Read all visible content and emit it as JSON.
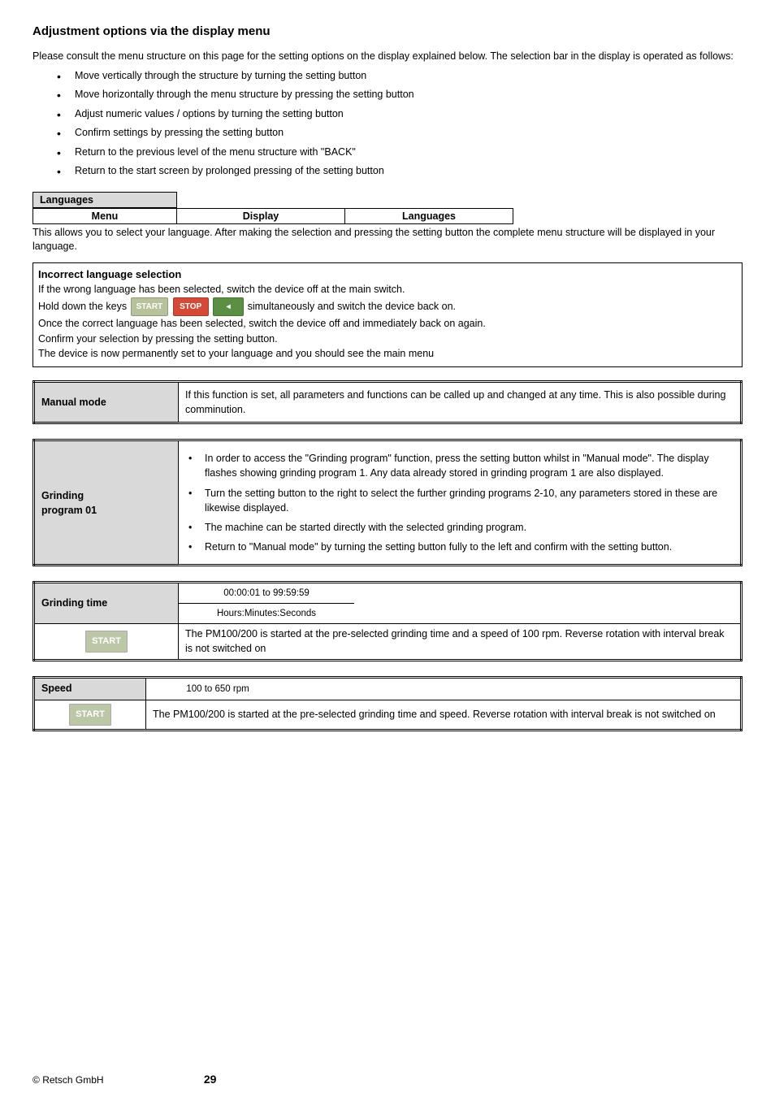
{
  "title": "Adjustment options via the display menu",
  "intro": "Please consult the menu structure on this page for the setting options on the display explained below. The selection bar in the display is operated as follows:",
  "bullets": [
    "Move vertically through the structure by turning the setting button",
    "Move horizontally through the menu structure by pressing the setting button",
    "Adjust numeric values / options by turning the setting button",
    "Confirm settings by pressing the setting button",
    "Return to the previous level of the menu structure with \"BACK\"",
    "Return to the start screen by prolonged pressing of the setting button"
  ],
  "lang": {
    "header": "Languages",
    "col1": "Menu",
    "col2": "Display",
    "col3": "Languages",
    "note": "This allows you to select your language. After making the selection and pressing the setting button the complete menu structure will be displayed in your language."
  },
  "warn": {
    "title": "Incorrect language selection",
    "l1": "If the wrong language has been selected, switch the device off at the main switch.",
    "prehold": "Hold down the keys ",
    "posthold": " simultaneously and switch the device back on.",
    "l3": "Once the correct language has been selected, switch the device off and immediately back on again.",
    "l4": "Confirm your selection by pressing the setting button.",
    "l5": "The device is now permanently set to your language and you should see the main menu"
  },
  "buttons": {
    "start": "START",
    "stop": "STOP",
    "open": "◂"
  },
  "manual": {
    "label": "Manual mode",
    "text": "If this function is set, all parameters and functions can be called up and changed at any time. This is also possible during comminution."
  },
  "grindprog": {
    "label_l1": "Grinding",
    "label_l2": "program  01",
    "items": [
      "In order to access the \"Grinding program\" function, press the setting button whilst in \"Manual mode\". The display flashes showing grinding program 1. Any data already stored in grinding program 1 are also displayed.",
      "Turn the setting button to the right to select the further grinding programs 2-10, any parameters stored in these are likewise displayed.",
      "The machine can be started directly with the selected grinding program.",
      "Return to \"Manual mode\" by turning the setting button fully to the left and confirm with the setting button."
    ]
  },
  "grindtime": {
    "label": "Grinding time",
    "range": "00:00:01 to 99:59:59",
    "unit": "Hours:Minutes:Seconds",
    "note": "The PM100/200 is started at the pre-selected grinding time and a speed of 100 rpm. Reverse rotation with interval break is not switched on"
  },
  "speed": {
    "label": "Speed",
    "range": "100 to 650 rpm",
    "note": "The PM100/200 is started at the pre-selected grinding time and speed. Reverse rotation with interval break is not switched on"
  },
  "footer": {
    "copy": "© ",
    "company": "Retsch GmbH",
    "page": "29"
  }
}
